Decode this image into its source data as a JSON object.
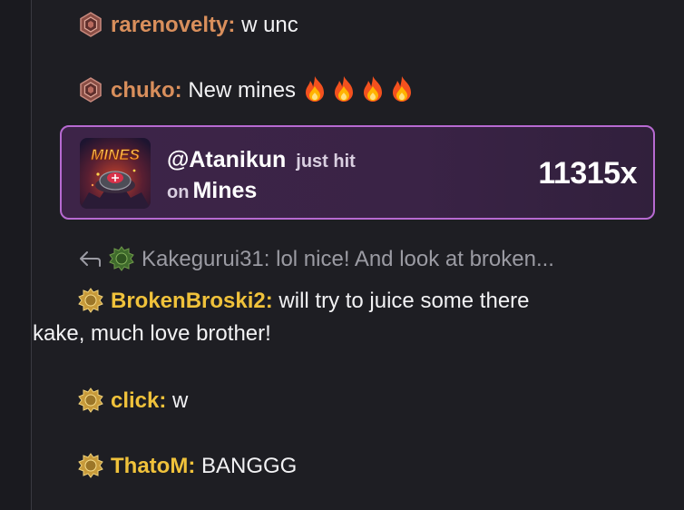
{
  "messages": [
    {
      "username": "rarenovelty:",
      "text": "w unc",
      "badge": "copper-hex-badge"
    },
    {
      "username": "chuko:",
      "text": "New mines",
      "badge": "copper-hex-badge",
      "emojis": [
        "fire-icon",
        "fire-icon",
        "fire-icon",
        "fire-icon"
      ]
    },
    {
      "username": "BrokenBroski2:",
      "text": "will try to juice some there",
      "text2": "kake, much love brother!",
      "badge": "gold-gear-badge"
    },
    {
      "username": "click:",
      "text": "w",
      "badge": "gold-gear-badge"
    },
    {
      "username": "ThatoM:",
      "text": "BANGGG",
      "badge": "gold-gear-badge"
    }
  ],
  "win": {
    "user": "@Atanikun",
    "hit_label": "just hit",
    "on_label": "on",
    "game": "Mines",
    "multiplier": "11315x",
    "thumb_text": "MINES"
  },
  "reply": {
    "username": "Kakegurui31:",
    "text": "lol nice! And look at broken..."
  },
  "colors": {
    "background": "#1e1e23",
    "copper_user": "#d98f5c",
    "gold_user": "#f0c23b",
    "card_border": "#b76ad1"
  }
}
